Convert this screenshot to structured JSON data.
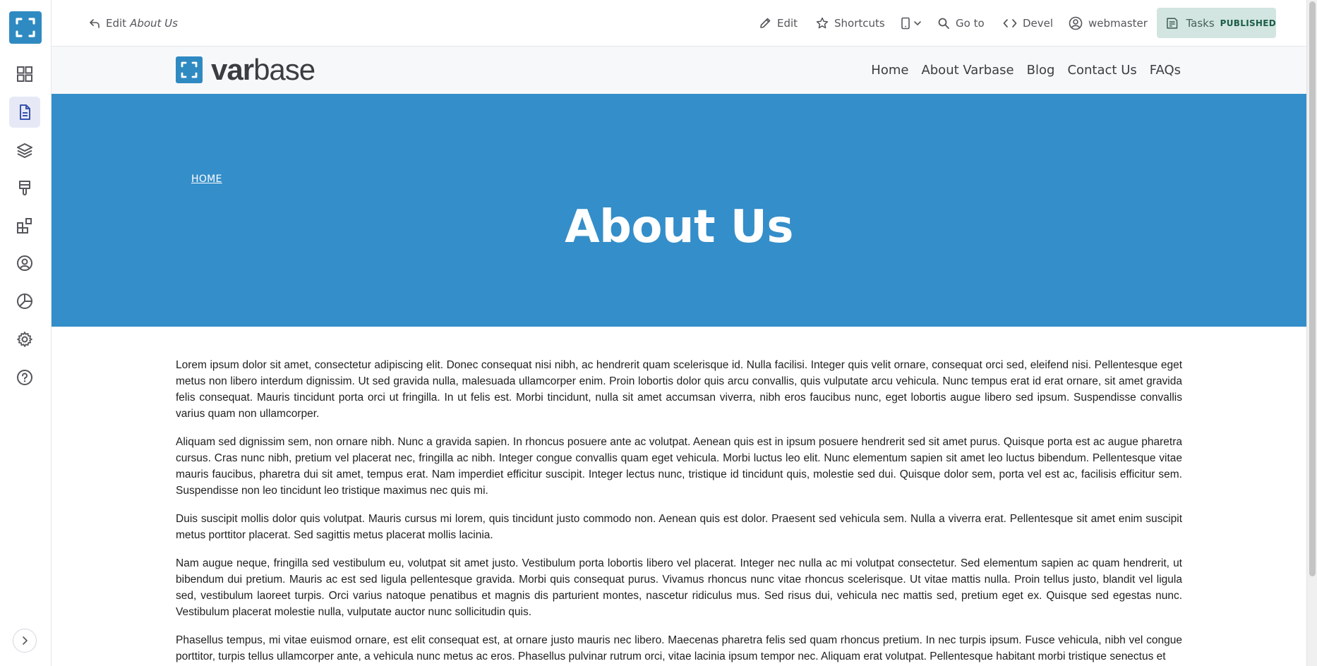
{
  "toolbar": {
    "back_label": "Edit",
    "back_title": "About Us",
    "edit": "Edit",
    "shortcuts": "Shortcuts",
    "goto": "Go to",
    "devel": "Devel",
    "user": "webmaster",
    "tasks": "Tasks",
    "status": "PUBLISHED"
  },
  "sidebar": {
    "items": [
      {
        "icon": "dashboard-icon"
      },
      {
        "icon": "content-icon",
        "active": true
      },
      {
        "icon": "structure-icon"
      },
      {
        "icon": "appearance-icon"
      },
      {
        "icon": "extend-icon"
      },
      {
        "icon": "people-icon"
      },
      {
        "icon": "reports-icon"
      },
      {
        "icon": "config-icon"
      },
      {
        "icon": "help-icon"
      }
    ]
  },
  "site": {
    "brand_bold": "var",
    "brand_light": "base",
    "nav": [
      "Home",
      "About Varbase",
      "Blog",
      "Contact Us",
      "FAQs"
    ]
  },
  "hero": {
    "breadcrumb": "HOME",
    "title": "About Us"
  },
  "body": {
    "paragraphs": [
      "Lorem ipsum dolor sit amet, consectetur adipiscing elit. Donec consequat nisi nibh, ac hendrerit quam scelerisque id. Nulla facilisi. Integer quis velit ornare, consequat orci sed, eleifend nisi. Pellentesque eget metus non libero interdum dignissim. Ut sed gravida nulla, malesuada ullamcorper enim. Proin lobortis dolor quis arcu convallis, quis vulputate arcu vehicula. Nunc tempus erat id erat ornare, sit amet gravida felis consequat. Mauris tincidunt porta orci ut fringilla. In ut felis est. Morbi tincidunt, nulla sit amet accumsan viverra, nibh eros faucibus nunc, eget lobortis augue libero sed ipsum. Suspendisse convallis varius quam non ullamcorper.",
      "Aliquam sed dignissim sem, non ornare nibh. Nunc a gravida sapien. In rhoncus posuere ante ac volutpat. Aenean quis est in ipsum posuere hendrerit sed sit amet purus. Quisque porta est ac augue pharetra cursus. Cras nunc nibh, pretium vel placerat nec, fringilla ac nibh. Integer congue convallis quam eget vehicula. Morbi luctus leo elit. Nunc elementum sapien sit amet leo luctus bibendum. Pellentesque vitae mauris faucibus, pharetra dui sit amet, tempus erat. Nam imperdiet efficitur suscipit. Integer lectus nunc, tristique id tincidunt quis, molestie sed dui. Quisque dolor sem, porta vel est ac, facilisis efficitur sem. Suspendisse non leo tincidunt leo tristique maximus nec quis mi.",
      "Duis suscipit mollis dolor quis volutpat. Mauris cursus mi lorem, quis tincidunt justo commodo non. Aenean quis est dolor. Praesent sed vehicula sem. Nulla a viverra erat. Pellentesque sit amet enim suscipit metus porttitor placerat. Sed sagittis metus placerat mollis lacinia.",
      "Nam augue neque, fringilla sed vestibulum eu, volutpat sit amet justo. Vestibulum porta lobortis libero vel placerat. Integer nec nulla ac mi volutpat consectetur. Sed elementum sapien ac quam hendrerit, ut bibendum dui pretium. Mauris ac est sed ligula pellentesque gravida. Morbi quis consequat purus. Vivamus rhoncus nunc vitae rhoncus scelerisque. Ut vitae mattis nulla. Proin tellus justo, blandit vel ligula sed, vestibulum laoreet turpis. Orci varius natoque penatibus et magnis dis parturient montes, nascetur ridiculus mus. Sed risus dui, vehicula nec mattis sed, pretium eget ex. Quisque sed egestas nunc. Vestibulum placerat molestie nulla, vulputate auctor nunc sollicitudin quis.",
      "Phasellus tempus, mi vitae euismod ornare, est elit consequat est, at ornare justo mauris nec libero. Maecenas pharetra felis sed quam rhoncus pretium. In nec turpis ipsum. Fusce vehicula, nibh vel congue porttitor, turpis tellus ullamcorper ante, a vehicula nunc metus ac eros. Phasellus pulvinar rutrum orci, vitae lacinia ipsum tempor nec. Aliquam erat volutpat. Pellentesque habitant morbi tristique senectus et"
    ]
  },
  "colors": {
    "brand": "#2f8ac2",
    "hero": "#348ec9",
    "tasks_bg": "#d2e5e0",
    "active_nav_bg": "#e6e9f5"
  }
}
